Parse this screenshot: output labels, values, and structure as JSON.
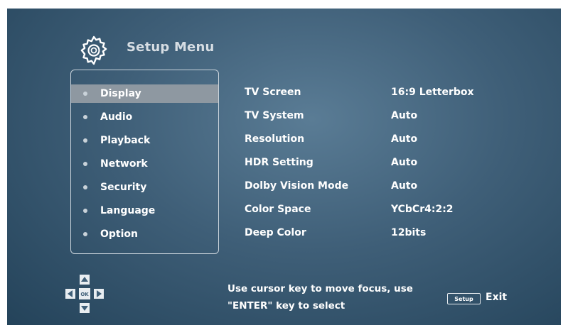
{
  "header": {
    "title": "Setup Menu",
    "icon": "gear-icon"
  },
  "menu": {
    "items": [
      {
        "label": "Display",
        "active": true
      },
      {
        "label": "Audio",
        "active": false
      },
      {
        "label": "Playback",
        "active": false
      },
      {
        "label": "Network",
        "active": false
      },
      {
        "label": "Security",
        "active": false
      },
      {
        "label": "Language",
        "active": false
      },
      {
        "label": "Option",
        "active": false
      }
    ]
  },
  "settings": [
    {
      "label": "TV Screen",
      "value": "16:9 Letterbox"
    },
    {
      "label": "TV System",
      "value": "Auto"
    },
    {
      "label": "Resolution",
      "value": "Auto"
    },
    {
      "label": "HDR Setting",
      "value": "Auto"
    },
    {
      "label": "Dolby Vision Mode",
      "value": "Auto"
    },
    {
      "label": "Color Space",
      "value": "YCbCr4:2:2"
    },
    {
      "label": "Deep Color",
      "value": "12bits"
    }
  ],
  "footer": {
    "dpad_center_label": "OK",
    "hint_line1": "Use cursor key to move focus, use",
    "hint_line2": "\"ENTER\" key to select",
    "setup_key_label": "Setup",
    "exit_label": "Exit"
  },
  "colors": {
    "background": "#3f5f78",
    "active_item": "#8e98a1",
    "text": "#ffffff"
  }
}
